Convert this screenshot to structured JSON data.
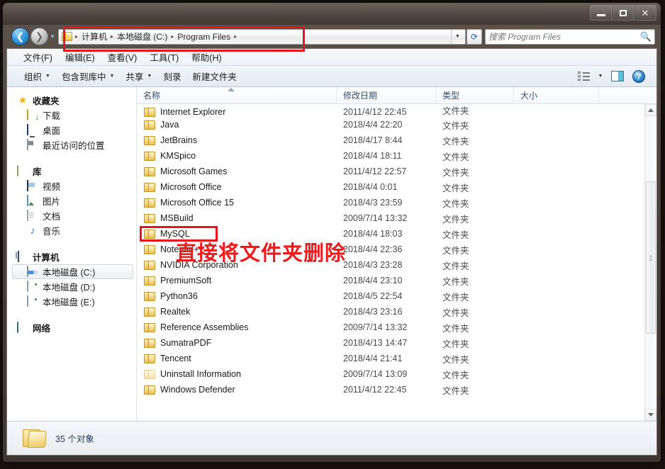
{
  "window": {
    "controls": {
      "minimize": "最小化",
      "maximize": "最大化",
      "close": "关闭"
    }
  },
  "nav": {
    "back_label": "后退",
    "forward_label": "前进",
    "recent_dropdown": "最近浏览的位置",
    "refresh_label": "刷新",
    "breadcrumbs": [
      "计算机",
      "本地磁盘 (C:)",
      "Program Files"
    ],
    "separator": "▸"
  },
  "search": {
    "placeholder": "搜索 Program Files",
    "value": "",
    "icon": "search-icon"
  },
  "menubar": {
    "items": [
      {
        "label": "文件(F)"
      },
      {
        "label": "编辑(E)"
      },
      {
        "label": "查看(V)"
      },
      {
        "label": "工具(T)"
      },
      {
        "label": "帮助(H)"
      }
    ]
  },
  "toolbar": {
    "items": [
      {
        "label": "组织",
        "caret": true
      },
      {
        "label": "包含到库中",
        "caret": true
      },
      {
        "label": "共享",
        "caret": true
      },
      {
        "label": "刻录",
        "caret": false
      },
      {
        "label": "新建文件夹",
        "caret": false
      }
    ],
    "right": {
      "views_icon": "views-icon",
      "views_caret": "▼",
      "preview_pane_icon": "preview-pane-icon",
      "help_icon": "help-icon",
      "help_glyph": "?"
    }
  },
  "sidebar": {
    "groups": [
      {
        "header": {
          "label": "收藏夹",
          "icon": "star-icon"
        },
        "items": [
          {
            "label": "下载",
            "icon": "downloads-icon"
          },
          {
            "label": "桌面",
            "icon": "desktop-icon"
          },
          {
            "label": "最近访问的位置",
            "icon": "recent-places-icon"
          }
        ]
      },
      {
        "header": {
          "label": "库",
          "icon": "library-icon"
        },
        "items": [
          {
            "label": "视频",
            "icon": "video-icon"
          },
          {
            "label": "图片",
            "icon": "pictures-icon"
          },
          {
            "label": "文档",
            "icon": "documents-icon"
          },
          {
            "label": "音乐",
            "icon": "music-icon"
          }
        ]
      },
      {
        "header": {
          "label": "计算机",
          "icon": "computer-icon"
        },
        "items": [
          {
            "label": "本地磁盘 (C:)",
            "icon": "hdd-system-icon",
            "selected": true
          },
          {
            "label": "本地磁盘 (D:)",
            "icon": "hdd-icon",
            "selected": false
          },
          {
            "label": "本地磁盘 (E:)",
            "icon": "hdd-icon",
            "selected": false
          }
        ]
      },
      {
        "header": {
          "label": "网络",
          "icon": "network-icon"
        },
        "items": []
      }
    ]
  },
  "filelist": {
    "columns": [
      {
        "key": "name",
        "label": "名称",
        "sorted": "asc"
      },
      {
        "key": "date",
        "label": "修改日期"
      },
      {
        "key": "type",
        "label": "类型"
      },
      {
        "key": "size",
        "label": "大小"
      }
    ],
    "rows": [
      {
        "name": "Internet Explorer",
        "date": "2011/4/12 22:45",
        "type": "文件夹",
        "size": "",
        "dim": false,
        "partial": true
      },
      {
        "name": "Java",
        "date": "2018/4/4 22:20",
        "type": "文件夹",
        "size": "",
        "dim": false
      },
      {
        "name": "JetBrains",
        "date": "2018/4/17 8:44",
        "type": "文件夹",
        "size": "",
        "dim": false
      },
      {
        "name": "KMSpico",
        "date": "2018/4/4 18:11",
        "type": "文件夹",
        "size": "",
        "dim": false
      },
      {
        "name": "Microsoft Games",
        "date": "2011/4/12 22:57",
        "type": "文件夹",
        "size": "",
        "dim": false
      },
      {
        "name": "Microsoft Office",
        "date": "2018/4/4 0:01",
        "type": "文件夹",
        "size": "",
        "dim": false
      },
      {
        "name": "Microsoft Office 15",
        "date": "2018/4/3 23:59",
        "type": "文件夹",
        "size": "",
        "dim": false
      },
      {
        "name": "MSBuild",
        "date": "2009/7/14 13:32",
        "type": "文件夹",
        "size": "",
        "dim": false
      },
      {
        "name": "MySQL",
        "date": "2018/4/4 18:03",
        "type": "文件夹",
        "size": "",
        "dim": false,
        "highlighted": true
      },
      {
        "name": "Notepad++",
        "date": "2018/4/4 22:36",
        "type": "文件夹",
        "size": "",
        "dim": false
      },
      {
        "name": "NVIDIA Corporation",
        "date": "2018/4/3 23:28",
        "type": "文件夹",
        "size": "",
        "dim": false
      },
      {
        "name": "PremiumSoft",
        "date": "2018/4/4 23:10",
        "type": "文件夹",
        "size": "",
        "dim": false
      },
      {
        "name": "Python36",
        "date": "2018/4/5 22:54",
        "type": "文件夹",
        "size": "",
        "dim": false
      },
      {
        "name": "Realtek",
        "date": "2018/4/3 23:16",
        "type": "文件夹",
        "size": "",
        "dim": false
      },
      {
        "name": "Reference Assemblies",
        "date": "2009/7/14 13:32",
        "type": "文件夹",
        "size": "",
        "dim": false
      },
      {
        "name": "SumatraPDF",
        "date": "2018/4/13 14:47",
        "type": "文件夹",
        "size": "",
        "dim": false
      },
      {
        "name": "Tencent",
        "date": "2018/4/4 21:41",
        "type": "文件夹",
        "size": "",
        "dim": false
      },
      {
        "name": "Uninstall Information",
        "date": "2009/7/14 13:09",
        "type": "文件夹",
        "size": "",
        "dim": true
      },
      {
        "name": "Windows Defender",
        "date": "2011/4/12 22:45",
        "type": "文件夹",
        "size": "",
        "dim": false
      }
    ]
  },
  "statusbar": {
    "text": "35 个对象",
    "icon": "folder-large-icon"
  },
  "annotations": {
    "callout_text": "直接将文件夹删除",
    "color": "#ef1b1b",
    "highlight_targets": [
      "address-bar",
      "mysql-row"
    ]
  },
  "scrollbar": {
    "up_label": "向上滚动",
    "down_label": "向下滚动"
  }
}
